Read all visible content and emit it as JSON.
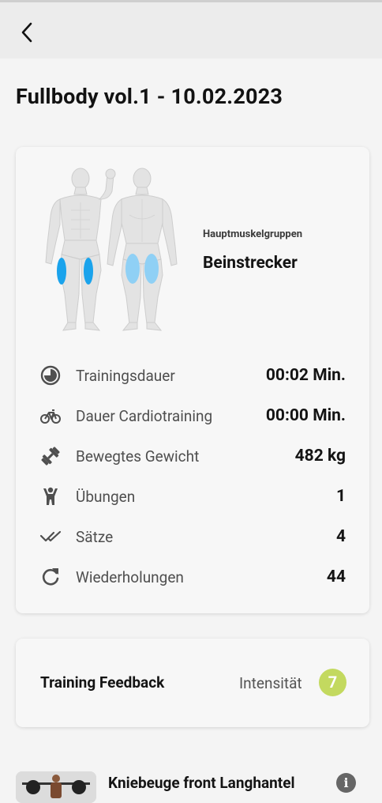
{
  "header": {
    "back_icon": "chevron-left-icon"
  },
  "workout": {
    "title": "Fullbody vol.1 - 10.02.2023"
  },
  "summary": {
    "muscle_caption": "Hauptmuskelgruppen",
    "muscle_value": "Beinstrecker",
    "highlight_color": "#1aa3ec",
    "highlight_color_light": "#8fd0f5",
    "stats": [
      {
        "icon": "clock-half-icon",
        "label": "Trainingsdauer",
        "value": "00:02 Min."
      },
      {
        "icon": "bicycle-icon",
        "label": "Dauer Cardiotraining",
        "value": "00:00 Min."
      },
      {
        "icon": "dumbbell-icon",
        "label": "Bewegtes Gewicht",
        "value": "482 kg"
      },
      {
        "icon": "person-icon",
        "label": "Übungen",
        "value": "1"
      },
      {
        "icon": "double-check-icon",
        "label": "Sätze",
        "value": "4"
      },
      {
        "icon": "refresh-icon",
        "label": "Wiederholungen",
        "value": "44"
      }
    ]
  },
  "feedback": {
    "title": "Training Feedback",
    "label": "Intensität",
    "value": "7",
    "badge_color": "#c3d95f"
  },
  "exercise": {
    "title": "Kniebeuge front Langhantel",
    "info_icon": "info-icon"
  }
}
